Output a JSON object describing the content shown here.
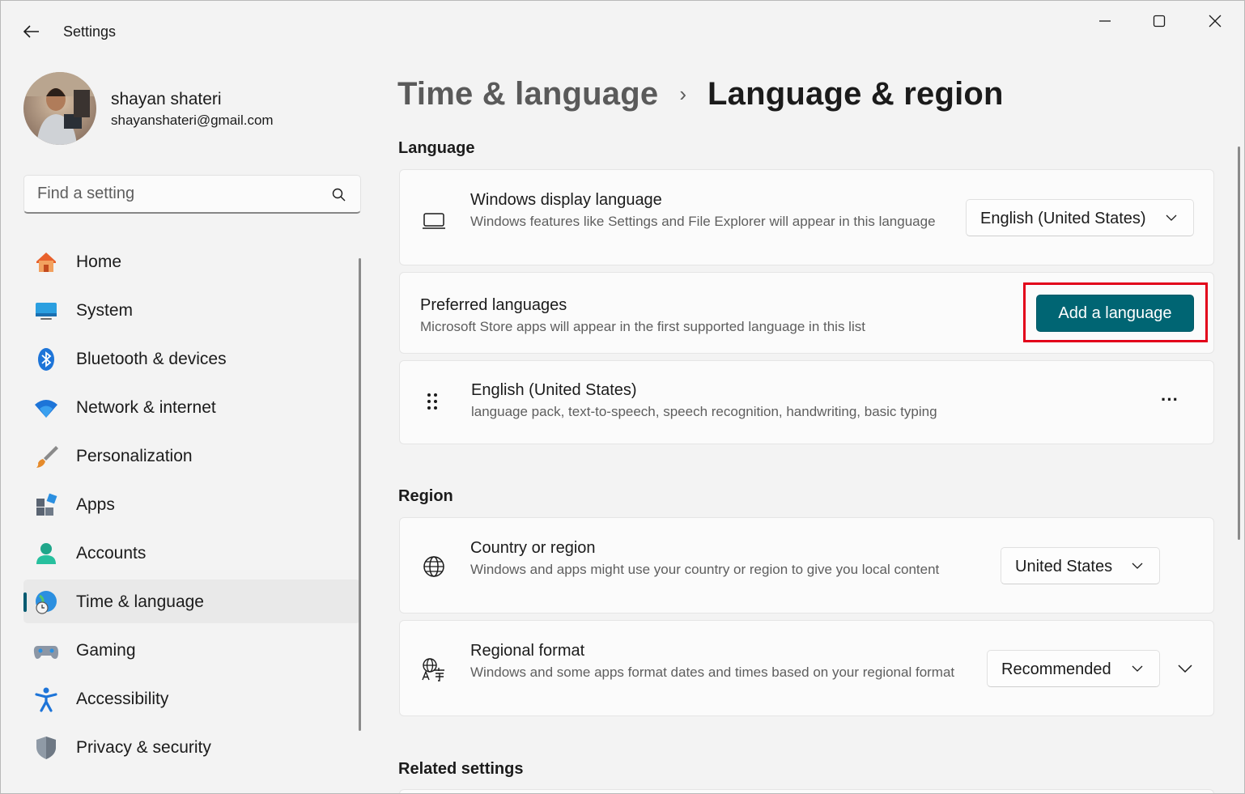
{
  "window": {
    "title": "Settings",
    "back_icon": "back-arrow-icon",
    "controls": [
      "minimize-icon",
      "maximize-icon",
      "close-icon"
    ]
  },
  "profile": {
    "name": "shayan shateri",
    "email": "shayanshateri@gmail.com"
  },
  "search": {
    "placeholder": "Find a setting",
    "value": ""
  },
  "sidebar": {
    "items": [
      {
        "label": "Home",
        "icon": "home-icon",
        "active": false
      },
      {
        "label": "System",
        "icon": "system-icon",
        "active": false
      },
      {
        "label": "Bluetooth & devices",
        "icon": "bluetooth-icon",
        "active": false
      },
      {
        "label": "Network & internet",
        "icon": "wifi-icon",
        "active": false
      },
      {
        "label": "Personalization",
        "icon": "paintbrush-icon",
        "active": false
      },
      {
        "label": "Apps",
        "icon": "apps-icon",
        "active": false
      },
      {
        "label": "Accounts",
        "icon": "accounts-icon",
        "active": false
      },
      {
        "label": "Time & language",
        "icon": "globe-clock-icon",
        "active": true
      },
      {
        "label": "Gaming",
        "icon": "gamepad-icon",
        "active": false
      },
      {
        "label": "Accessibility",
        "icon": "accessibility-icon",
        "active": false
      },
      {
        "label": "Privacy & security",
        "icon": "shield-icon",
        "active": false
      }
    ]
  },
  "breadcrumb": {
    "parent": "Time & language",
    "separator": "›",
    "current": "Language & region"
  },
  "language_section": {
    "title": "Language",
    "display_language": {
      "title": "Windows display language",
      "description": "Windows features like Settings and File Explorer will appear in this language",
      "value": "English (United States)",
      "icon": "laptop-icon"
    },
    "preferred": {
      "title": "Preferred languages",
      "description": "Microsoft Store apps will appear in the first supported language in this list",
      "button": "Add a language"
    },
    "installed": {
      "title": "English (United States)",
      "description": "language pack, text-to-speech, speech recognition, handwriting, basic typing",
      "more": "···"
    }
  },
  "region_section": {
    "title": "Region",
    "country": {
      "title": "Country or region",
      "description": "Windows and apps might use your country or region to give you local content",
      "value": "United States",
      "icon": "globe-icon"
    },
    "format": {
      "title": "Regional format",
      "description": "Windows and some apps format dates and times based on your regional format",
      "value": "Recommended",
      "icon": "language-format-icon"
    }
  },
  "related": {
    "title": "Related settings"
  },
  "colors": {
    "accent": "#006573",
    "highlight": "#e2001a"
  }
}
